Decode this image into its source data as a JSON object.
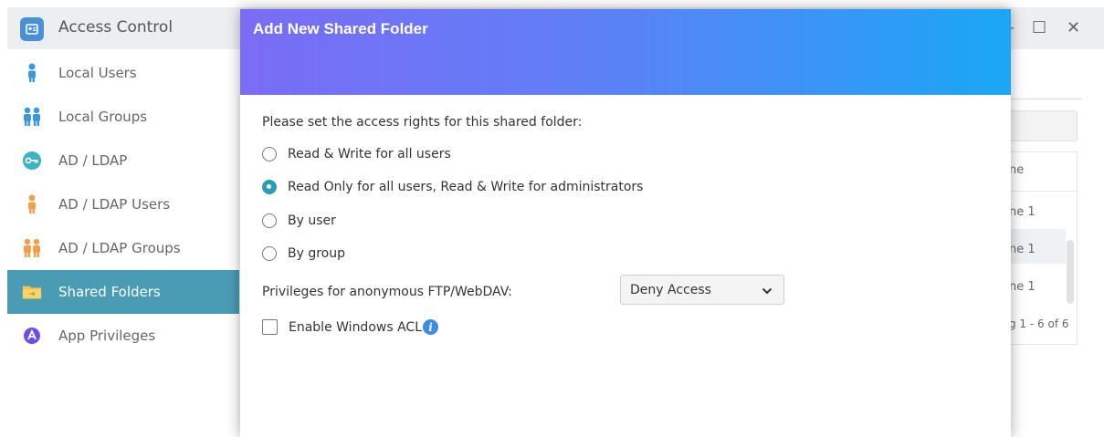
{
  "window": {
    "title": "Access Control",
    "controls": [
      "–",
      "☐",
      "✕"
    ]
  },
  "sidebar": {
    "items": [
      {
        "label": "Local Users",
        "icon": "user-icon",
        "color": "#3a9ad9"
      },
      {
        "label": "Local Groups",
        "icon": "group-icon",
        "color": "#3a9ad9"
      },
      {
        "label": "AD / LDAP",
        "icon": "key-icon",
        "color": "#3bb3c4"
      },
      {
        "label": "AD / LDAP Users",
        "icon": "user-icon",
        "color": "#f0a04b"
      },
      {
        "label": "AD / LDAP Groups",
        "icon": "group-icon",
        "color": "#f0a04b"
      },
      {
        "label": "Shared Folders",
        "icon": "folder-icon",
        "color": "#f3c44c",
        "active": true
      },
      {
        "label": "App Privileges",
        "icon": "app-privileges-icon",
        "color": "#6a4fe0"
      }
    ]
  },
  "background": {
    "column_header": "ne",
    "rows": [
      "ne 1",
      "ne 1",
      "ne 1"
    ],
    "pagination": "g 1 - 6 of 6"
  },
  "dialog": {
    "title": "Add New Shared Folder",
    "prompt": "Please set the access rights for this shared folder:",
    "options": [
      {
        "label": "Read & Write for all users",
        "checked": false
      },
      {
        "label": "Read Only for all users, Read & Write for administrators",
        "checked": true
      },
      {
        "label": "By user",
        "checked": false
      },
      {
        "label": "By group",
        "checked": false
      }
    ],
    "anonymous_label": "Privileges for anonymous FTP/WebDAV:",
    "anonymous_value": "Deny Access",
    "acl_label": "Enable Windows ACL",
    "acl_checked": false,
    "info_glyph": "i"
  },
  "colors": {
    "accent": "#2a9cb5",
    "sidebar_active": "#4a9cb4",
    "header_gradient_start": "#7b6cf6",
    "header_gradient_end": "#1aa7f5"
  }
}
